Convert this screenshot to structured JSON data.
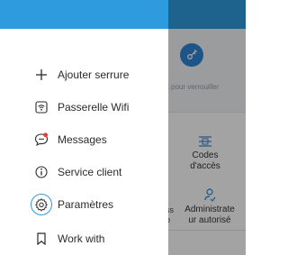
{
  "accent_color": "#2f9bdf",
  "background_app": {
    "hint_text": "ment pour verrouiller",
    "tiles": [
      {
        "label_line1": "Codes",
        "label_line2": "d'accès",
        "icon": "keypad-icon"
      },
      {
        "label_line1": "Administrate",
        "label_line2": "ur autorisé",
        "icon": "user-check-icon"
      }
    ],
    "clipped_left": {
      "line1": "ss",
      "line2": "b"
    }
  },
  "drawer": {
    "menu": [
      {
        "label": "Ajouter serrure",
        "icon": "plus-icon"
      },
      {
        "label": "Passerelle Wifi",
        "icon": "wifi-gateway-icon"
      },
      {
        "label": "Messages",
        "icon": "message-icon",
        "badge": true
      },
      {
        "label": "Service client",
        "icon": "info-icon"
      },
      {
        "label": "Paramètres",
        "icon": "gear-icon",
        "highlighted": true
      },
      {
        "label": "Work with",
        "icon": "bookmark-icon"
      }
    ]
  }
}
